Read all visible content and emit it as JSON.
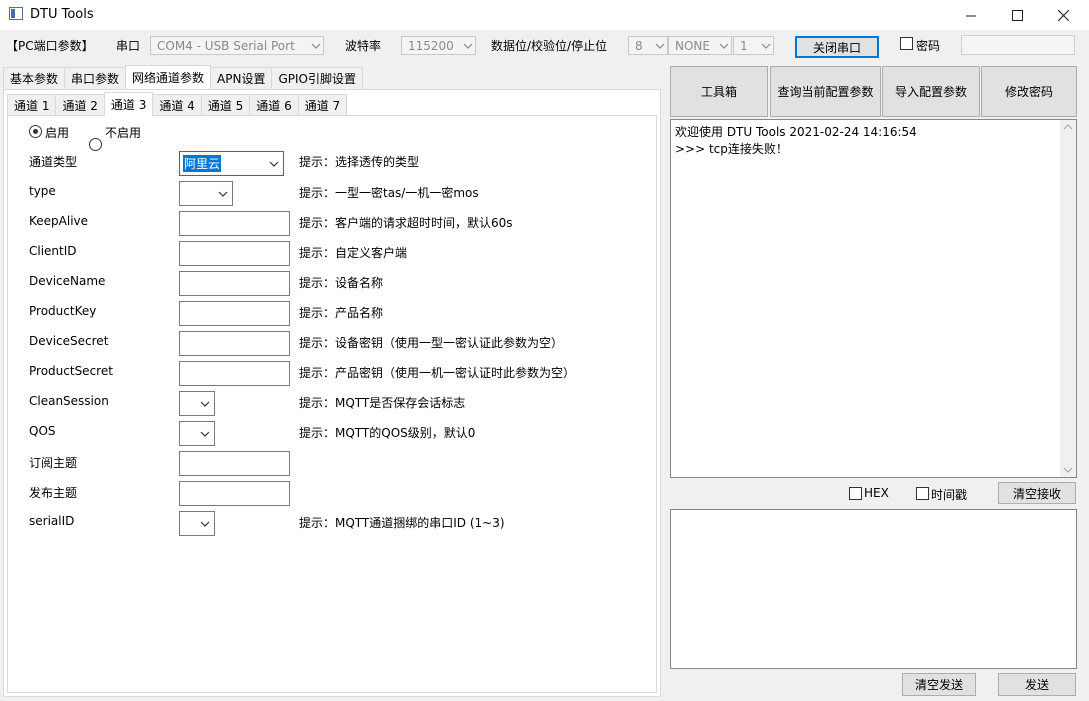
{
  "window": {
    "title": "DTU Tools"
  },
  "serial_bar": {
    "section_label": "【PC端口参数】",
    "port_label": "串口",
    "port_value": "COM4 - USB Serial Port",
    "baud_label": "波特率",
    "baud_value": "115200",
    "format_label": "数据位/校验位/停止位",
    "databits_value": "8",
    "parity_value": "NONE",
    "stopbits_value": "1",
    "close_port_label": "关闭串口",
    "password_label": "密码"
  },
  "main_tabs": [
    "基本参数",
    "串口参数",
    "网络通道参数",
    "APN设置",
    "GPIO引脚设置"
  ],
  "main_tab_active": 2,
  "channel_tabs": [
    "通道 1",
    "通道 2",
    "通道 3",
    "通道 4",
    "通道 5",
    "通道 6",
    "通道 7"
  ],
  "channel_tab_active": 2,
  "enable": {
    "on_label": "启用",
    "off_label": "不启用",
    "selected": "启用"
  },
  "fields": {
    "channel_type": {
      "label": "通道类型",
      "value": "阿里云",
      "hint": "提示：选择透传的类型"
    },
    "type": {
      "label": "type",
      "value": "",
      "hint": "提示：一型一密tas/一机一密mos"
    },
    "keepalive": {
      "label": "KeepAlive",
      "value": "",
      "hint": "提示：客户端的请求超时时间，默认60s"
    },
    "clientid": {
      "label": "ClientID",
      "value": "",
      "hint": "提示：自定义客户端"
    },
    "devicename": {
      "label": "DeviceName",
      "value": "",
      "hint": "提示：设备名称"
    },
    "productkey": {
      "label": "ProductKey",
      "value": "",
      "hint": "提示：产品名称"
    },
    "devicesecret": {
      "label": "DeviceSecret",
      "value": "",
      "hint": "提示：设备密钥（使用一型一密认证此参数为空）"
    },
    "productsecret": {
      "label": "ProductSecret",
      "value": "",
      "hint": "提示：产品密钥（使用一机一密认证时此参数为空）"
    },
    "cleansession": {
      "label": "CleanSession",
      "value": "",
      "hint": "提示：MQTT是否保存会话标志"
    },
    "qos": {
      "label": "QOS",
      "value": "",
      "hint": "提示：MQTT的QOS级别，默认0"
    },
    "subscribe": {
      "label": "订阅主题",
      "value": ""
    },
    "publish": {
      "label": "发布主题",
      "value": ""
    },
    "serialid": {
      "label": "serialID",
      "value": "",
      "hint": "提示：MQTT通道捆绑的串口ID (1~3)"
    }
  },
  "toolbar": {
    "toolbox": "工具箱",
    "query_config": "查询当前配置参数",
    "import_config": "导入配置参数",
    "change_password": "修改密码"
  },
  "log": {
    "lines": [
      "欢迎使用 DTU Tools 2021-02-24 14:16:54",
      ">>> tcp连接失败！"
    ]
  },
  "receive_options": {
    "hex_label": "HEX",
    "timestamp_label": "时间戳",
    "clear_receive": "清空接收"
  },
  "send": {
    "clear_send": "清空发送",
    "send": "发送",
    "value": ""
  }
}
